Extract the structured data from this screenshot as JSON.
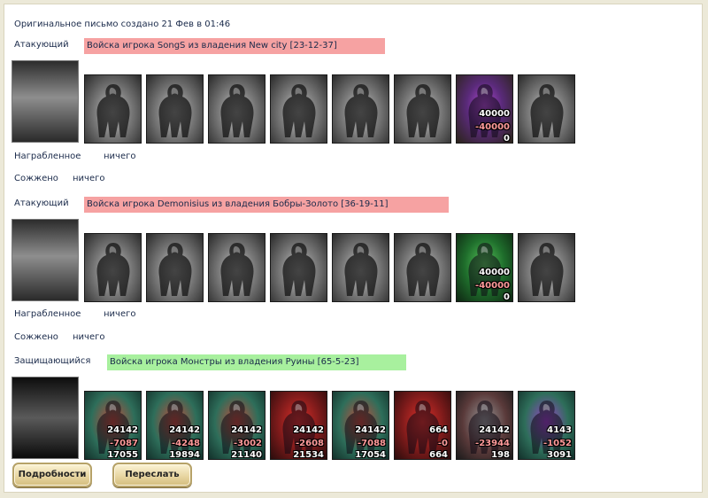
{
  "header": {
    "created": "Оригинальное письмо создано 21 Фев в 01:46"
  },
  "groups": [
    {
      "role": "Атакующий",
      "banner": "Войска игрока SongS из владения New city [23-12-37]",
      "banner_color": "#f6a2a2",
      "portrait_icon": "dark-knight-emblem-icon",
      "units": [
        {
          "icon": "golem-icon"
        },
        {
          "icon": "sorceress-icon"
        },
        {
          "icon": "knight-icon"
        },
        {
          "icon": "griffin-icon"
        },
        {
          "icon": "archer-icon"
        },
        {
          "icon": "mage-icon"
        },
        {
          "icon": "lich-icon",
          "counts": [
            "40000",
            "-40000",
            "0"
          ]
        },
        {
          "icon": "spider-rider-icon"
        }
      ],
      "looted_label": "Награбленное",
      "looted_value": "ничего",
      "burned_label": "Сожжено",
      "burned_value": "ничего"
    },
    {
      "role": "Атакующий",
      "banner": "Войска игрока Demonisius из владения Бобры-Золото [36-19-11]",
      "banner_color": "#f6a2a2",
      "portrait_icon": "shield-crossed-arrows-emblem-icon",
      "units": [
        {
          "icon": "dwarf-icon"
        },
        {
          "icon": "swordsman-icon"
        },
        {
          "icon": "centaur-icon"
        },
        {
          "icon": "griffin-icon"
        },
        {
          "icon": "archer-icon"
        },
        {
          "icon": "priestess-icon"
        },
        {
          "icon": "druid-icon",
          "counts": [
            "40000",
            "-40000",
            "0"
          ]
        },
        {
          "icon": "ent-icon"
        }
      ],
      "looted_label": "Награбленное",
      "looted_value": "ничего",
      "burned_label": "Сожжено",
      "burned_value": "ничего"
    },
    {
      "role": "Защищающийся",
      "banner": "Войска игрока Монстры из владения Руины [65-5-23]",
      "banner_color": "#a8f09e",
      "portrait_icon": "demon-skull-emblem-icon",
      "units": [
        {
          "icon": "lizard-warrior-icon",
          "counts": [
            "24142",
            "-7087",
            "17055"
          ]
        },
        {
          "icon": "orc-brute-icon",
          "counts": [
            "24142",
            "-4248",
            "19894"
          ]
        },
        {
          "icon": "goblin-shaman-icon",
          "counts": [
            "24142",
            "-3002",
            "21140"
          ]
        },
        {
          "icon": "red-demon-icon",
          "counts": [
            "24142",
            "-2608",
            "21534"
          ]
        },
        {
          "icon": "scorpion-beast-icon",
          "counts": [
            "24142",
            "-7088",
            "17054"
          ]
        },
        {
          "icon": "fire-demon-icon",
          "counts": [
            "664",
            "-0",
            "664"
          ]
        },
        {
          "icon": "bone-dragon-icon",
          "counts": [
            "24142",
            "-23944",
            "198"
          ]
        },
        {
          "icon": "dark-sorcerer-icon",
          "counts": [
            "4143",
            "-1052",
            "3091"
          ]
        }
      ]
    }
  ],
  "buttons": {
    "details": "Подробности",
    "forward": "Переслать"
  }
}
